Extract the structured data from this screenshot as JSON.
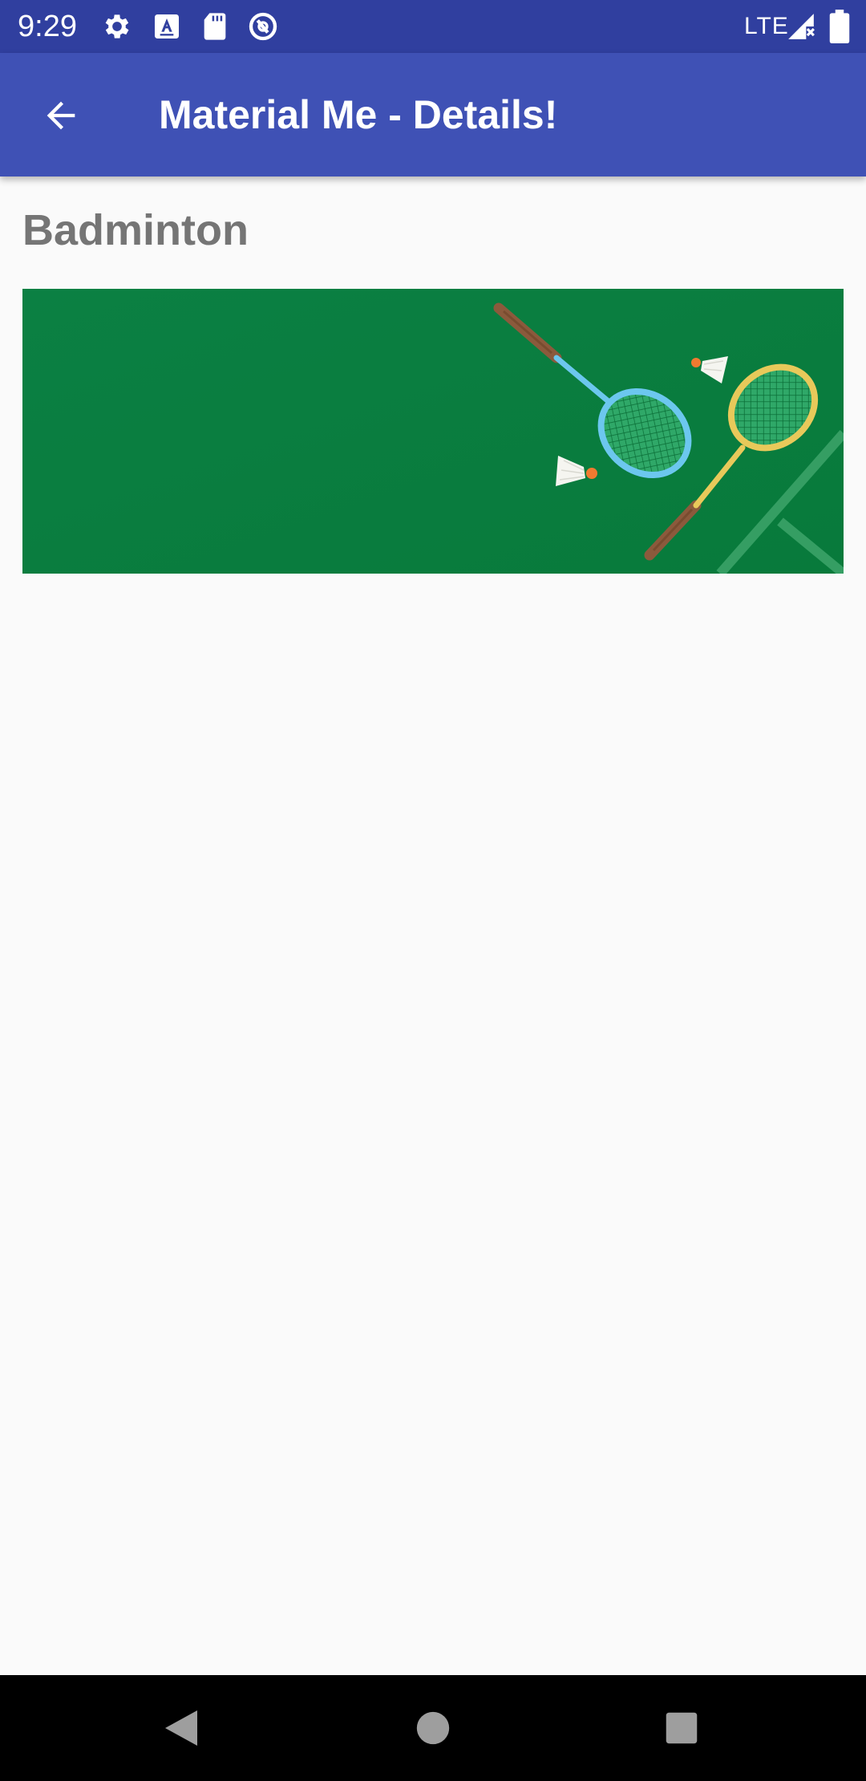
{
  "status_bar": {
    "time": "9:29",
    "network": "LTE",
    "icons": [
      "gear-icon",
      "text-a-icon",
      "sd-card-icon",
      "sync-circle-icon",
      "signal-icon",
      "battery-icon"
    ]
  },
  "app_bar": {
    "title": "Material Me - Details!",
    "back_icon": "arrow-back-icon"
  },
  "content": {
    "title": "Badminton",
    "image_name": "badminton-image"
  },
  "nav_bar": {
    "buttons": [
      "back-triangle-icon",
      "home-circle-icon",
      "recents-square-icon"
    ]
  },
  "colors": {
    "status_bar": "#303f9f",
    "app_bar": "#3f51b5",
    "background": "#fafafa",
    "title_text": "#757575",
    "court_green": "#0a7e3f"
  }
}
